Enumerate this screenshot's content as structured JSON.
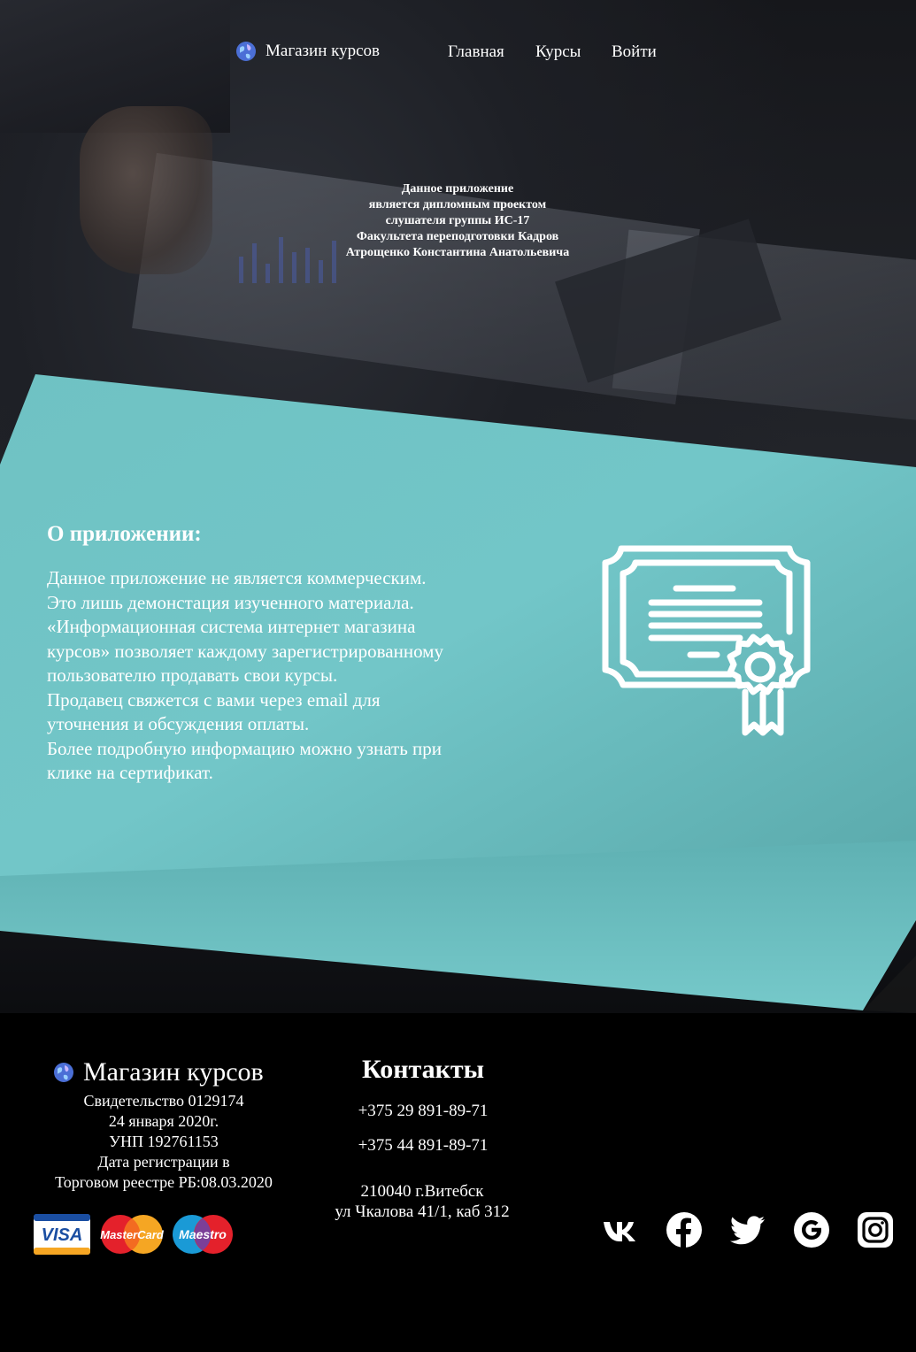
{
  "nav": {
    "brand": "Магазин курсов",
    "links": [
      "Главная",
      "Курсы",
      "Войти"
    ]
  },
  "intro": {
    "lines": [
      "Данное приложение",
      "является дипломным проектом",
      "слушателя группы ИС-17",
      "Факультета переподготовки Кадров",
      "Атрощенко Константина Анатольевича"
    ]
  },
  "about": {
    "title": "О приложении:",
    "lines": [
      "Данное приложение не является коммерческим.",
      "Это лишь демонстация изученного материала.",
      "«Информационная система интернет магазина",
      "курсов» позволяет каждому зарегистрированному",
      "пользователю продавать свои курсы.",
      "Продавец свяжется с вами через email для",
      "уточнения и обсуждения оплаты.",
      "Более подробную информацию можно узнать при",
      "клике на сертификат."
    ],
    "certificate_icon": "certificate-icon"
  },
  "footer": {
    "brand": "Магазин курсов",
    "info": [
      "Свидетельство 0129174",
      "24 января 2020г.",
      "УНП 192761153",
      "Дата регистрации в",
      "Торговом реестре РБ:08.03.2020"
    ],
    "payments": [
      "VISA",
      "MasterCard",
      "Maestro"
    ],
    "contacts_title": "Контакты",
    "phones": [
      "+375 29 891-89-71",
      "+375 44 891-89-71"
    ],
    "address": [
      "210040 г.Витебск",
      "ул Чкалова 41/1, каб 312"
    ],
    "social": [
      "vk-icon",
      "facebook-icon",
      "twitter-icon",
      "google-icon",
      "instagram-icon"
    ]
  },
  "colors": {
    "teal_light": "#74c7c8",
    "teal_dark": "#5aa9ab",
    "background": "#000000"
  }
}
